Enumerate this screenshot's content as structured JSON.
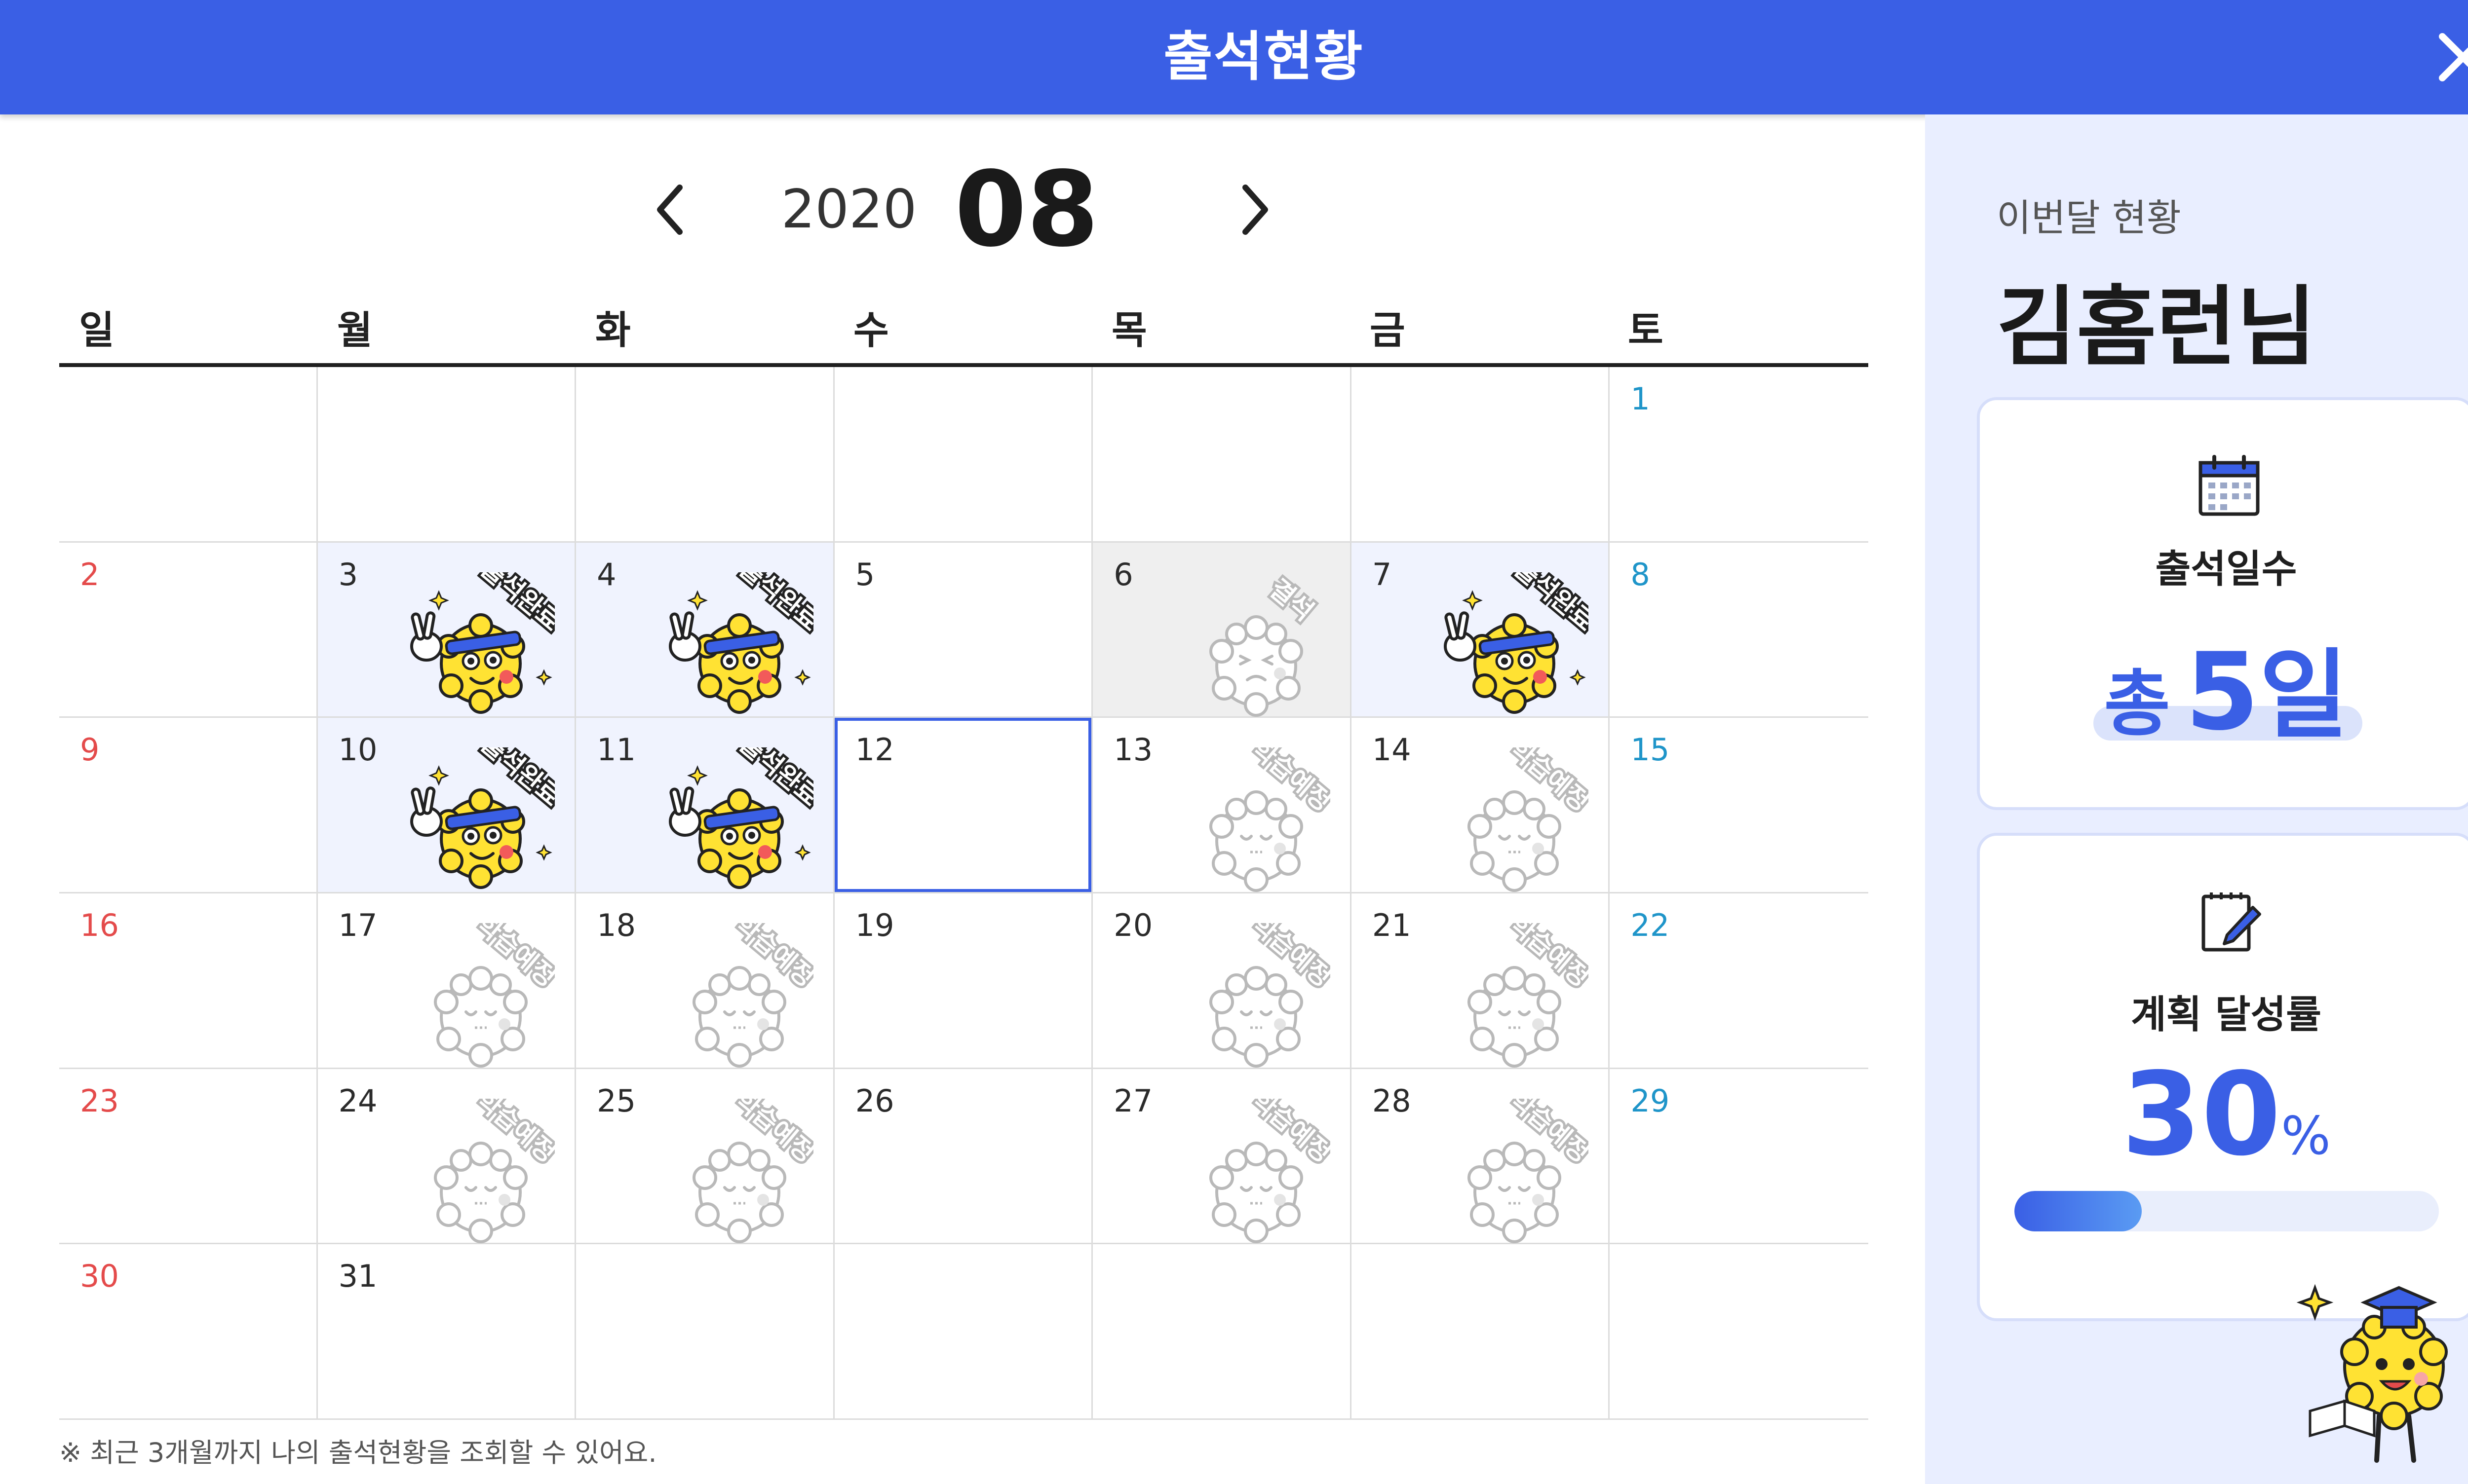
{
  "header": {
    "title": "출석현황",
    "close_icon": "close-icon"
  },
  "nav": {
    "year": "2020",
    "month": "08",
    "prev_icon": "chevron-left-icon",
    "next_icon": "chevron-right-icon"
  },
  "weekdays": [
    "일",
    "월",
    "화",
    "수",
    "목",
    "금",
    "토"
  ],
  "calendar": {
    "weeks": [
      [
        null,
        null,
        null,
        null,
        null,
        null,
        {
          "day": "1",
          "status": "none"
        }
      ],
      [
        {
          "day": "2",
          "status": "none"
        },
        {
          "day": "3",
          "status": "attended",
          "stamp": "출석완료"
        },
        {
          "day": "4",
          "status": "attended",
          "stamp": "출석완료"
        },
        {
          "day": "5",
          "status": "none"
        },
        {
          "day": "6",
          "status": "absent",
          "stamp": "결석"
        },
        {
          "day": "7",
          "status": "attended",
          "stamp": "출석완료"
        },
        {
          "day": "8",
          "status": "none"
        }
      ],
      [
        {
          "day": "9",
          "status": "none"
        },
        {
          "day": "10",
          "status": "attended",
          "stamp": "출석완료"
        },
        {
          "day": "11",
          "status": "attended",
          "stamp": "출석완료"
        },
        {
          "day": "12",
          "status": "today"
        },
        {
          "day": "13",
          "status": "planned",
          "stamp": "학습예정"
        },
        {
          "day": "14",
          "status": "planned",
          "stamp": "학습예정"
        },
        {
          "day": "15",
          "status": "none"
        }
      ],
      [
        {
          "day": "16",
          "status": "none"
        },
        {
          "day": "17",
          "status": "planned",
          "stamp": "학습예정"
        },
        {
          "day": "18",
          "status": "planned",
          "stamp": "학습예정"
        },
        {
          "day": "19",
          "status": "none"
        },
        {
          "day": "20",
          "status": "planned",
          "stamp": "학습예정"
        },
        {
          "day": "21",
          "status": "planned",
          "stamp": "학습예정"
        },
        {
          "day": "22",
          "status": "none"
        }
      ],
      [
        {
          "day": "23",
          "status": "none"
        },
        {
          "day": "24",
          "status": "planned",
          "stamp": "학습예정"
        },
        {
          "day": "25",
          "status": "planned",
          "stamp": "학습예정"
        },
        {
          "day": "26",
          "status": "none"
        },
        {
          "day": "27",
          "status": "planned",
          "stamp": "학습예정"
        },
        {
          "day": "28",
          "status": "planned",
          "stamp": "학습예정"
        },
        {
          "day": "29",
          "status": "none"
        }
      ],
      [
        {
          "day": "30",
          "status": "none"
        },
        {
          "day": "31",
          "status": "none"
        },
        null,
        null,
        null,
        null,
        null
      ]
    ]
  },
  "footnote": "※ 최근 3개월까지 나의 출석현황을 조회할 수 있어요.",
  "side": {
    "subtitle": "이번달 현황",
    "name": "김홈런님",
    "attendance": {
      "icon": "calendar-icon",
      "label": "출석일수",
      "prefix": "총",
      "count": "5",
      "unit": "일"
    },
    "plan": {
      "icon": "notepad-pencil-icon",
      "label": "계획 달성률",
      "value": "30",
      "unit": "%",
      "progress": 0.3
    },
    "mascot_icon": "graduate-mascot-icon"
  },
  "colors": {
    "primary": "#3a5fe5",
    "sunday": "#e44b4b",
    "saturday": "#1f95c9",
    "attended_bg": "#f0f3fe",
    "absent_bg": "#efefef",
    "panel_bg": "#e9eeff"
  }
}
